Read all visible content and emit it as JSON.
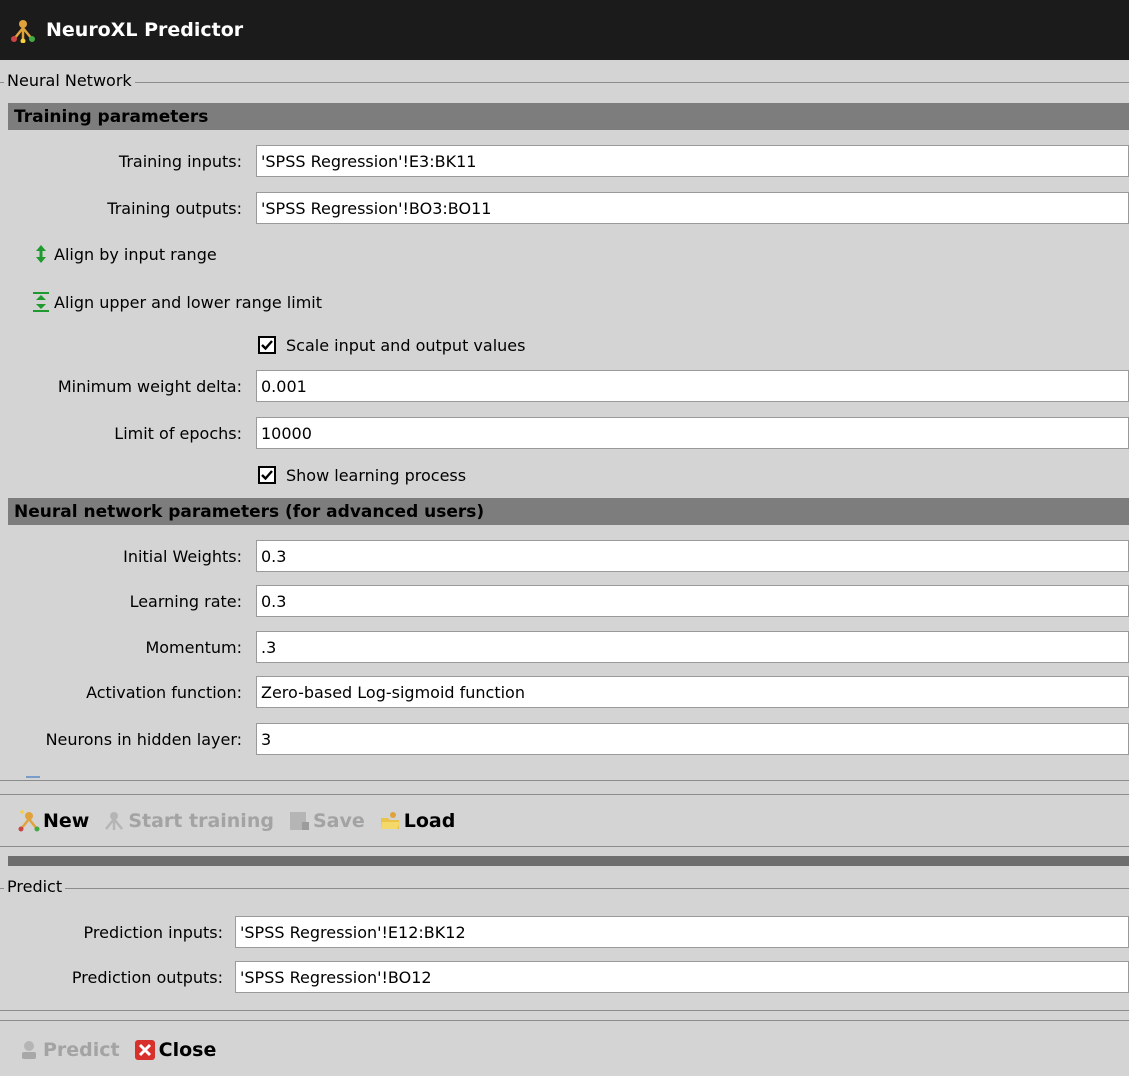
{
  "window": {
    "title": "NeuroXL Predictor",
    "icon": "neuroxl-app-icon"
  },
  "neural_network": {
    "legend": "Neural Network",
    "training": {
      "header": "Training parameters",
      "training_inputs": {
        "label": "Training  inputs:",
        "value": "'SPSS Regression'!E3:BK11"
      },
      "training_outputs": {
        "label": "Training outputs:",
        "value": "'SPSS Regression'!BO3:BO11"
      },
      "align_input": {
        "label": "Align by input range",
        "icon": "align-arrows-icon"
      },
      "align_limits": {
        "label": "Align upper and lower range limit",
        "icon": "align-limits-icon"
      },
      "scale_values": {
        "label": "Scale input and output values",
        "checked": true
      },
      "min_weight_delta": {
        "label": "Minimum weight delta:",
        "value": "0.001"
      },
      "limit_epochs": {
        "label": "Limit of epochs:",
        "value": "10000"
      },
      "show_learning": {
        "label": "Show learning process",
        "checked": true
      }
    },
    "network": {
      "header": "Neural network parameters (for advanced users)",
      "initial_weights": {
        "label": "Initial Weights:",
        "value": "0.3"
      },
      "learning_rate": {
        "label": "Learning rate:",
        "value": "0.3"
      },
      "momentum": {
        "label": "Momentum:",
        "value": ".3"
      },
      "activation": {
        "label": "Activation function:",
        "value": "Zero-based Log-sigmoid function"
      },
      "hidden_neurons": {
        "label": "Neurons in hidden layer:",
        "value": "3"
      }
    },
    "toolbar": {
      "new": {
        "label": "New",
        "icon": "new-network-icon",
        "enabled": true
      },
      "start_training": {
        "label": "Start training",
        "icon": "training-icon",
        "enabled": false
      },
      "save": {
        "label": "Save",
        "icon": "save-icon",
        "enabled": false
      },
      "load": {
        "label": "Load",
        "icon": "load-folder-icon",
        "enabled": true
      }
    }
  },
  "predict": {
    "legend": "Predict",
    "prediction_inputs": {
      "label": "Prediction inputs:",
      "value": "'SPSS Regression'!E12:BK12"
    },
    "prediction_outputs": {
      "label": "Prediction outputs:",
      "value": "'SPSS Regression'!BO12"
    },
    "toolbar": {
      "predict": {
        "label": "Predict",
        "icon": "predict-icon",
        "enabled": false
      },
      "close": {
        "label": "Close",
        "icon": "close-icon",
        "enabled": true
      }
    }
  },
  "colors": {
    "title_bar": "#1b1b1b",
    "panel": "#d4d4d4",
    "section_header": "#7d7d7d",
    "disabled_text": "#a3a3a3",
    "close_red": "#d8302a"
  }
}
